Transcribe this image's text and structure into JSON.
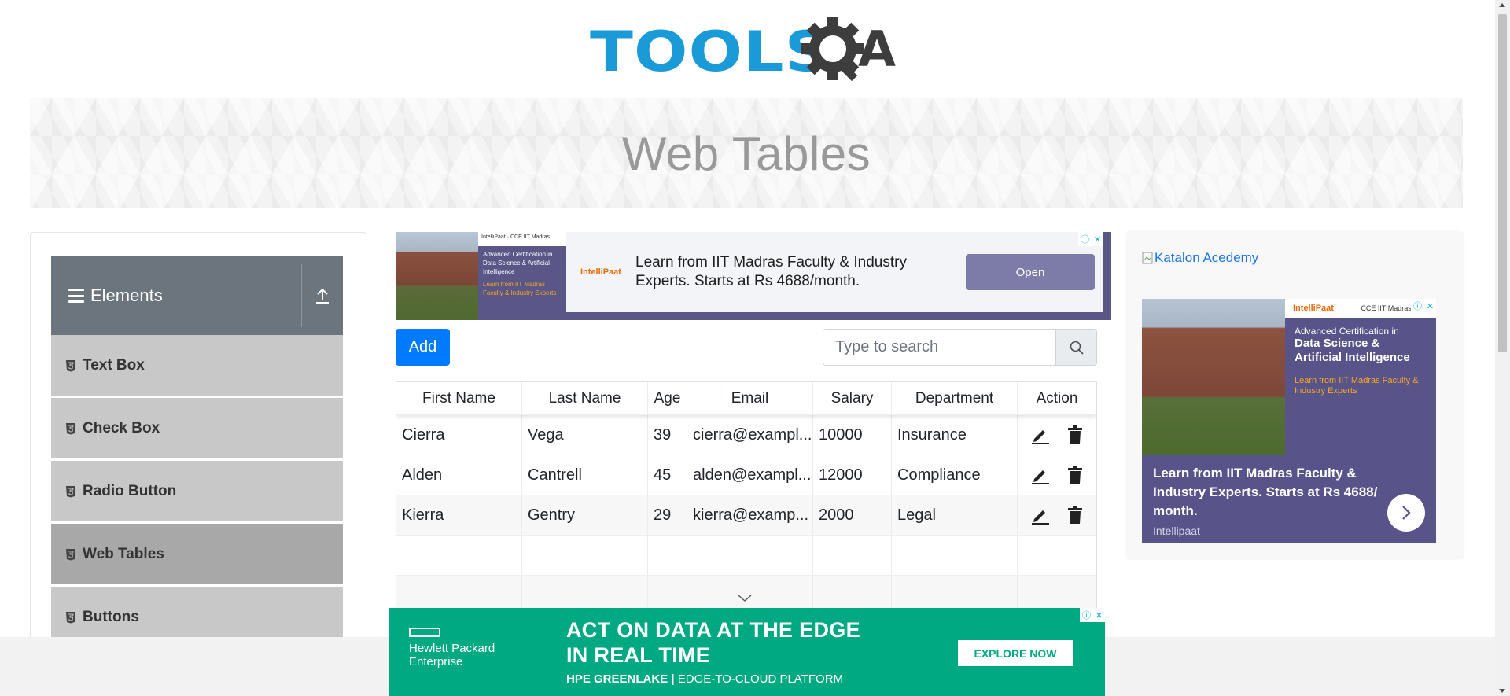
{
  "logo": {
    "text": "TOOLS",
    "suffix": "QA"
  },
  "page_title": "Web Tables",
  "sidebar": {
    "group_title": "Elements",
    "items": [
      {
        "label": "Text Box",
        "active": false
      },
      {
        "label": "Check Box",
        "active": false
      },
      {
        "label": "Radio Button",
        "active": false
      },
      {
        "label": "Web Tables",
        "active": true
      },
      {
        "label": "Buttons",
        "active": false
      }
    ]
  },
  "ad_top": {
    "message": "Learn from IIT Madras Faculty & Industry Experts. Starts at Rs 4688/month.",
    "button": "Open",
    "brand": "IntelliPaat",
    "mini_title": "Advanced Certification in Data Science & Artificial Intelligence",
    "mini_sub": "Learn from IIT Madras Faculty & Industry Experts",
    "mini_partner": "CCE IIT Madras"
  },
  "toolbar": {
    "add_label": "Add",
    "search_placeholder": "Type to search"
  },
  "table": {
    "columns": [
      "First Name",
      "Last Name",
      "Age",
      "Email",
      "Salary",
      "Department",
      "Action"
    ],
    "rows": [
      {
        "first": "Cierra",
        "last": "Vega",
        "age": "39",
        "email": "cierra@exampl...",
        "salary": "10000",
        "department": "Insurance"
      },
      {
        "first": "Alden",
        "last": "Cantrell",
        "age": "45",
        "email": "alden@exampl...",
        "salary": "12000",
        "department": "Compliance"
      },
      {
        "first": "Kierra",
        "last": "Gentry",
        "age": "29",
        "email": "kierra@examp...",
        "salary": "2000",
        "department": "Legal"
      }
    ]
  },
  "ad_right": {
    "broken_image_alt": "Katalon Acedemy",
    "partner": "CCE IIT Madras",
    "title_small": "Advanced Certification in",
    "title_big": "Data Science & Artificial Intelligence",
    "subtitle": "Learn from IIT Madras Faculty & Industry Experts",
    "message": "Learn from IIT Madras Faculty & Industry Experts. Starts at Rs 4688/ month.",
    "advertiser": "Intellipaat",
    "brand": "IntelliPaat"
  },
  "ad_bottom": {
    "brand_line1": "Hewlett Packard",
    "brand_line2": "Enterprise",
    "headline_line1": "ACT ON DATA AT THE EDGE",
    "headline_line2": "IN REAL TIME",
    "sub_bold": "HPE GREENLAKE |",
    "sub_rest": " EDGE-TO-CLOUD PLATFORM",
    "cta": "EXPLORE NOW"
  },
  "colors": {
    "primary": "#007bff",
    "sidebar_header": "#6c757d",
    "menu_item": "#c8c8c8",
    "menu_item_active": "#a8a8a8",
    "logo_blue": "#1a9bd7",
    "logo_dark": "#3d3d3d",
    "hpe_green": "#01a982"
  }
}
